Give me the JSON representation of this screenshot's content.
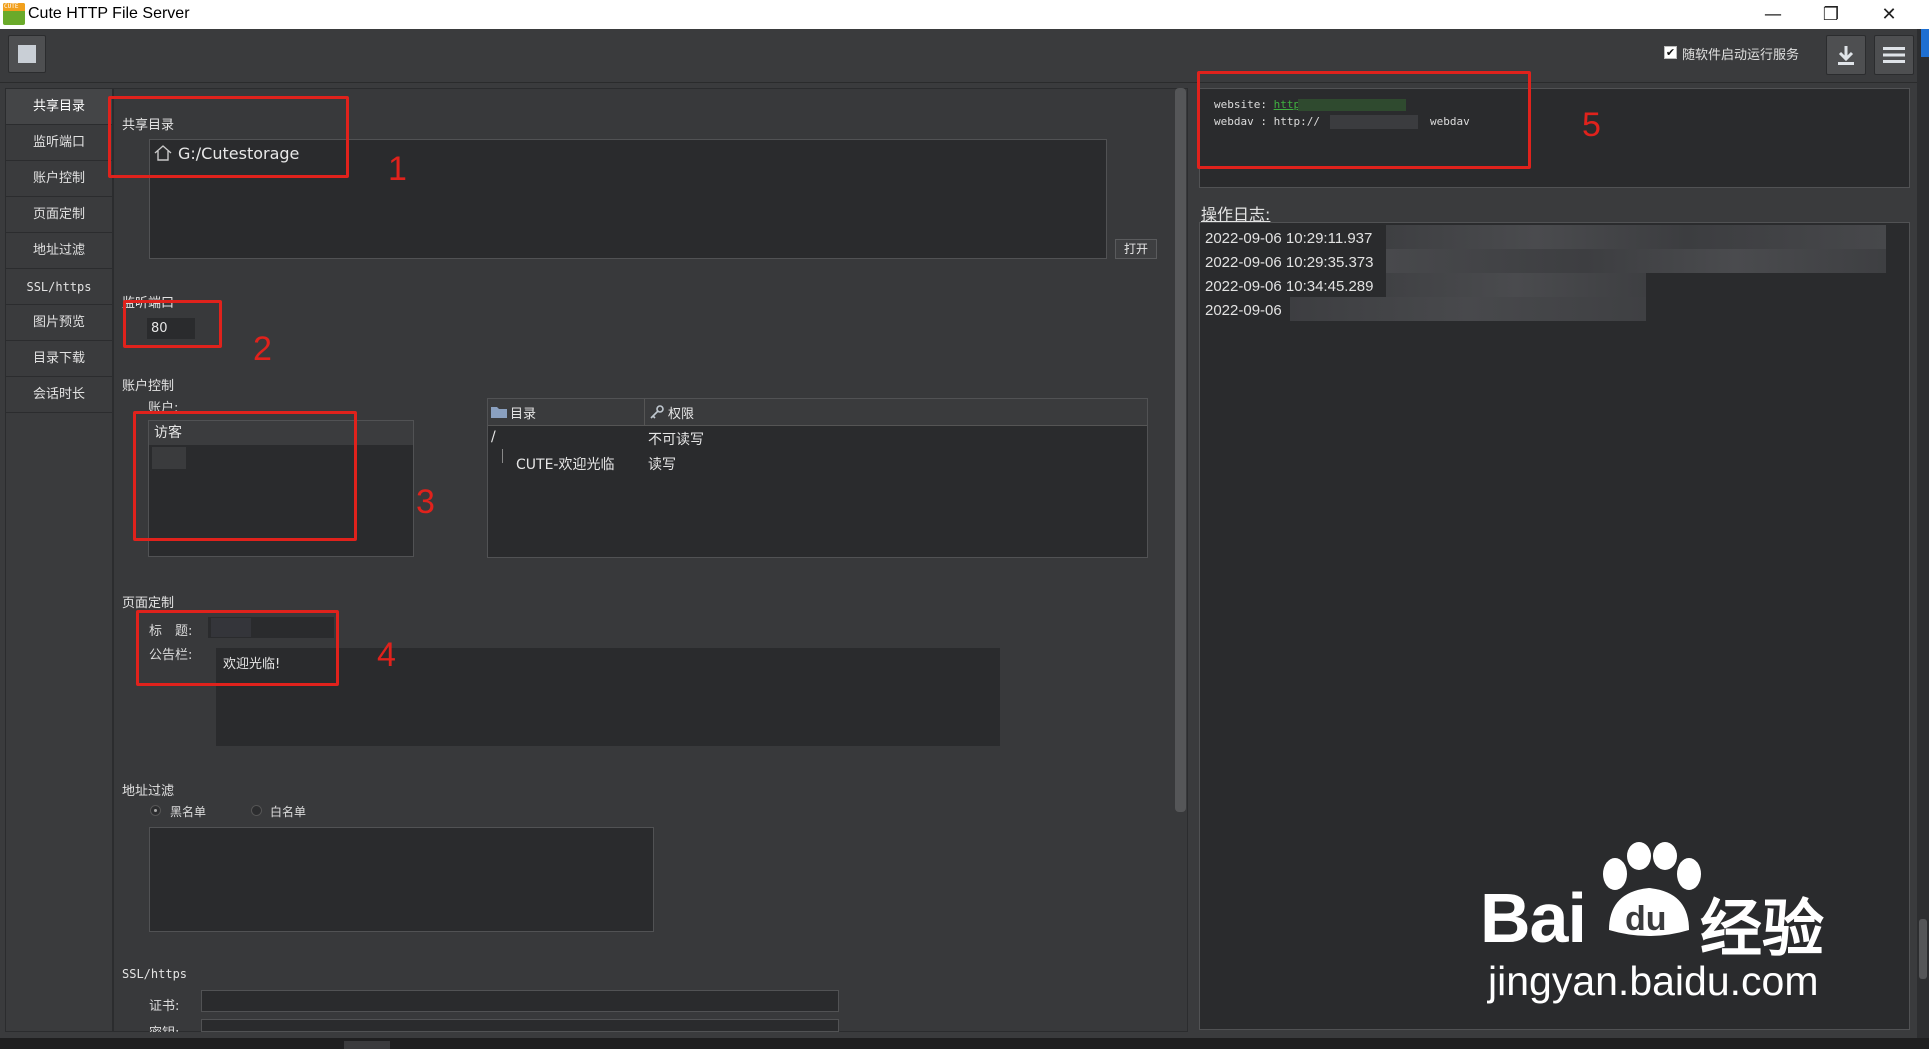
{
  "window": {
    "title": "Cute HTTP File Server",
    "logo_text": "CUTE",
    "minimize_glyph": "—",
    "restore_glyph": "❐",
    "close_glyph": "✕"
  },
  "toolbar": {
    "autostart_label": "随软件启动运行服务",
    "autostart_checked": true,
    "stop_icon": "stop-square-icon",
    "download_icon": "download-icon",
    "menu_icon": "hamburger-menu-icon"
  },
  "sidebar": {
    "items": [
      {
        "label": "共享目录"
      },
      {
        "label": "监听端口"
      },
      {
        "label": "账户控制"
      },
      {
        "label": "页面定制"
      },
      {
        "label": "地址过滤"
      },
      {
        "label": "SSL/https"
      },
      {
        "label": "图片预览"
      },
      {
        "label": "目录下载"
      },
      {
        "label": "会话时长"
      }
    ]
  },
  "share": {
    "section_label": "共享目录",
    "path": "G:/Cutestorage",
    "open_button": "打开"
  },
  "port": {
    "section_label": "监听端口",
    "value": "80"
  },
  "accounts": {
    "section_label": "账户控制",
    "account_label": "账户:",
    "users": [
      "访客"
    ],
    "perm_headers": {
      "dir": "目录",
      "perm": "权限"
    },
    "perm_rows": [
      {
        "dir": "/",
        "perm": "不可读写"
      },
      {
        "dir": "CUTE-欢迎光临",
        "perm": "读写"
      }
    ]
  },
  "page_custom": {
    "section_label": "页面定制",
    "title_label": "标　题:",
    "notice_label": "公告栏:",
    "notice_value": "欢迎光临!"
  },
  "address_filter": {
    "section_label": "地址过滤",
    "blacklist": "黑名单",
    "whitelist": "白名单"
  },
  "ssl": {
    "section_label": "SSL/https",
    "cert_label": "证书:",
    "key_label": "密钥:"
  },
  "urls": {
    "website_label": "website:",
    "website_prefix": "http://",
    "webdav_label": "webdav :",
    "webdav_prefix": "http://",
    "webdav_suffix": "webdav"
  },
  "log": {
    "title": "操作日志:",
    "entries": [
      "2022-09-06 10:29:11.937",
      "2022-09-06 10:29:35.373",
      "2022-09-06 10:34:45.289",
      "2022-09-06"
    ]
  },
  "annotations": [
    "1",
    "2",
    "3",
    "4",
    "5"
  ],
  "watermark": {
    "brand": "Bai",
    "brand_suffix": "经验",
    "url": "jingyan.baidu.com"
  },
  "colors": {
    "annotation_red": "#e0221c",
    "link_green": "#3fb03f",
    "panel_bg": "#38393b",
    "inset_bg": "#2a2b2d"
  }
}
